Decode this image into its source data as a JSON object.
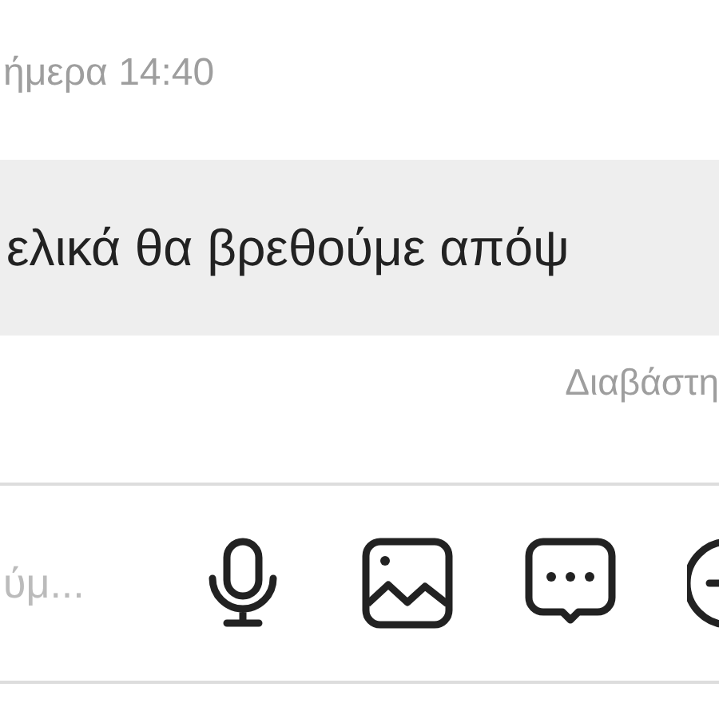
{
  "timestamp": "ήμερα 14:40",
  "message": {
    "text": "ελικά θα βρεθούμε απόψ"
  },
  "read_status": "Διαβάστη",
  "composer": {
    "placeholder": "ύμ..."
  }
}
